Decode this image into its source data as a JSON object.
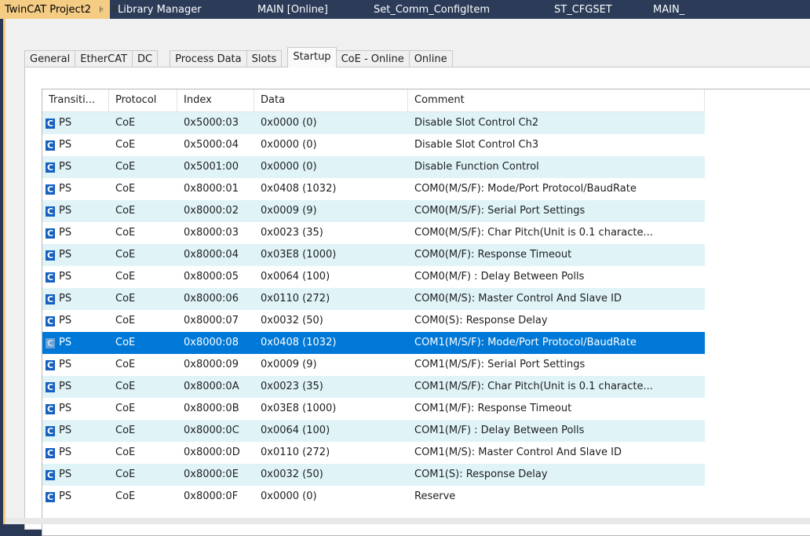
{
  "doc_tabs": [
    {
      "label": "TwinCAT Project2",
      "pin": "⊧",
      "close": "✕"
    },
    {
      "label": "Library Manager"
    },
    {
      "label": "MAIN [Online]"
    },
    {
      "label": "Set_Comm_ConfigItem"
    },
    {
      "label": "ST_CFGSET"
    },
    {
      "label": "MAIN_"
    }
  ],
  "prop_tabs": [
    "General",
    "EtherCAT",
    "DC",
    "Process Data",
    "Slots",
    "Startup",
    "CoE - Online",
    "Online"
  ],
  "active_prop_tab": "Startup",
  "table": {
    "columns": [
      "Transiti...",
      "Protocol",
      "Index",
      "Data",
      "Comment"
    ],
    "rows": [
      {
        "icon": "C",
        "transition": "PS",
        "protocol": "CoE",
        "index": "0x5000:03",
        "data": "0x0000 (0)",
        "comment": "Disable Slot Control Ch2"
      },
      {
        "icon": "C",
        "transition": "PS",
        "protocol": "CoE",
        "index": "0x5000:04",
        "data": "0x0000 (0)",
        "comment": "Disable Slot Control Ch3"
      },
      {
        "icon": "C",
        "transition": "PS",
        "protocol": "CoE",
        "index": "0x5001:00",
        "data": "0x0000 (0)",
        "comment": "Disable Function Control"
      },
      {
        "icon": "C",
        "transition": "PS",
        "protocol": "CoE",
        "index": "0x8000:01",
        "data": "0x0408 (1032)",
        "comment": "COM0(M/S/F):  Mode/Port Protocol/BaudRate"
      },
      {
        "icon": "C",
        "transition": "PS",
        "protocol": "CoE",
        "index": "0x8000:02",
        "data": "0x0009 (9)",
        "comment": "COM0(M/S/F):  Serial Port Settings"
      },
      {
        "icon": "C",
        "transition": "PS",
        "protocol": "CoE",
        "index": "0x8000:03",
        "data": "0x0023 (35)",
        "comment": "COM0(M/S/F):  Char Pitch(Unit is 0.1 characte..."
      },
      {
        "icon": "C",
        "transition": "PS",
        "protocol": "CoE",
        "index": "0x8000:04",
        "data": "0x03E8 (1000)",
        "comment": "COM0(M/F):  Response Timeout"
      },
      {
        "icon": "C",
        "transition": "PS",
        "protocol": "CoE",
        "index": "0x8000:05",
        "data": "0x0064 (100)",
        "comment": "COM0(M/F) : Delay Between Polls"
      },
      {
        "icon": "C",
        "transition": "PS",
        "protocol": "CoE",
        "index": "0x8000:06",
        "data": "0x0110 (272)",
        "comment": "COM0(M/S):  Master Control And Slave ID"
      },
      {
        "icon": "C",
        "transition": "PS",
        "protocol": "CoE",
        "index": "0x8000:07",
        "data": "0x0032 (50)",
        "comment": "COM0(S):  Response Delay"
      },
      {
        "icon": "C",
        "transition": "PS",
        "protocol": "CoE",
        "index": "0x8000:08",
        "data": "0x0408 (1032)",
        "comment": "COM1(M/S/F):  Mode/Port Protocol/BaudRate",
        "selected": true
      },
      {
        "icon": "C",
        "transition": "PS",
        "protocol": "CoE",
        "index": "0x8000:09",
        "data": "0x0009 (9)",
        "comment": "COM1(M/S/F):  Serial Port Settings"
      },
      {
        "icon": "C",
        "transition": "PS",
        "protocol": "CoE",
        "index": "0x8000:0A",
        "data": "0x0023 (35)",
        "comment": "COM1(M/S/F):  Char Pitch(Unit is 0.1 characte..."
      },
      {
        "icon": "C",
        "transition": "PS",
        "protocol": "CoE",
        "index": "0x8000:0B",
        "data": "0x03E8 (1000)",
        "comment": "COM1(M/F):  Response Timeout"
      },
      {
        "icon": "C",
        "transition": "PS",
        "protocol": "CoE",
        "index": "0x8000:0C",
        "data": "0x0064 (100)",
        "comment": "COM1(M/F) : Delay Between Polls"
      },
      {
        "icon": "C",
        "transition": "PS",
        "protocol": "CoE",
        "index": "0x8000:0D",
        "data": "0x0110 (272)",
        "comment": "COM1(M/S):  Master Control And Slave ID"
      },
      {
        "icon": "C",
        "transition": "PS",
        "protocol": "CoE",
        "index": "0x8000:0E",
        "data": "0x0032 (50)",
        "comment": "COM1(S):  Response Delay"
      },
      {
        "icon": "C",
        "transition": "PS",
        "protocol": "CoE",
        "index": "0x8000:0F",
        "data": "0x0000 (0)",
        "comment": "Reserve"
      }
    ]
  },
  "colors": {
    "selected_row": "#0078d7",
    "alt_row": "#e0f4f8",
    "active_doc_tab": "#f5cc84"
  }
}
